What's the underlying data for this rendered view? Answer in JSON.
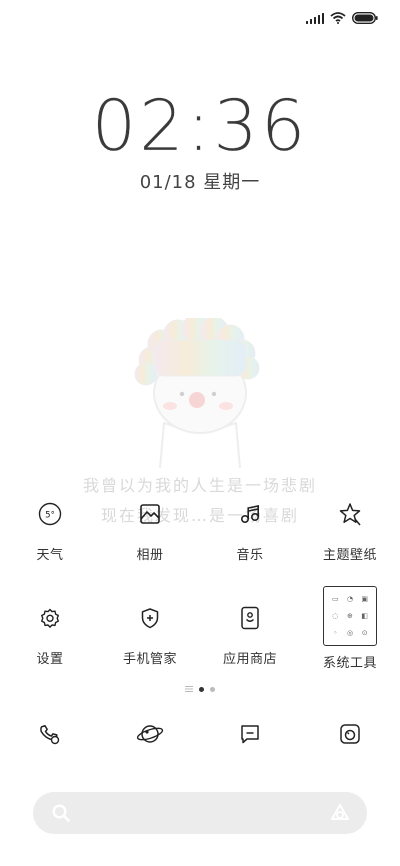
{
  "status": {
    "signal": "signal-icon",
    "wifi": "wifi-icon",
    "battery": "battery-icon"
  },
  "clock": {
    "time": "02:36",
    "date": "01/18 星期一"
  },
  "wallpaper": {
    "line1": "我曾以为我的人生是一场悲剧",
    "line2": "现在我发现…是一场喜剧"
  },
  "apps_row1": [
    {
      "label": "天气",
      "icon": "weather-icon",
      "badge": "5°"
    },
    {
      "label": "相册",
      "icon": "gallery-icon"
    },
    {
      "label": "音乐",
      "icon": "music-icon"
    },
    {
      "label": "主题壁纸",
      "icon": "theme-icon"
    }
  ],
  "apps_row2": [
    {
      "label": "设置",
      "icon": "settings-icon"
    },
    {
      "label": "手机管家",
      "icon": "security-icon"
    },
    {
      "label": "应用商店",
      "icon": "app-store-icon"
    },
    {
      "label": "系统工具",
      "icon": "folder-icon"
    }
  ],
  "page_indicator": {
    "pages": 2,
    "current": 1
  },
  "dock": [
    "phone-icon",
    "browser-icon",
    "messages-icon",
    "camera-icon"
  ],
  "search": {
    "left_icon": "search-icon",
    "right_icon": "assistant-icon"
  }
}
